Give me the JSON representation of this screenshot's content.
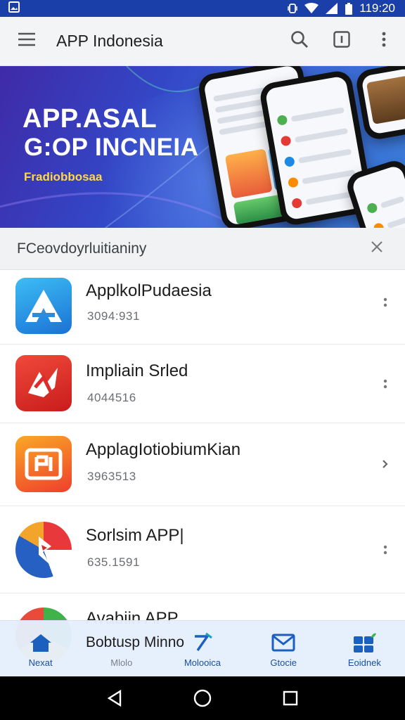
{
  "status_bar": {
    "time": "119:20",
    "icons": [
      "image-icon",
      "vibrate-icon",
      "wifi-icon",
      "signal-icon",
      "battery-icon"
    ]
  },
  "app_bar": {
    "title": "APP Indonesia",
    "icons": [
      "menu-icon",
      "search-icon",
      "info-icon",
      "more-vert-icon"
    ]
  },
  "banner": {
    "title_line1": "APP.ASAL",
    "title_line2": "G:OP INCNEIA",
    "subtitle": "Fradiobbosaa"
  },
  "section": {
    "title": "FCeovdoyrluitianiny",
    "close_icon": "close-icon"
  },
  "apps": [
    {
      "name": "ApplkolPudaesia",
      "count": "3094:931",
      "icon": "a-logo-icon",
      "colors": [
        "#2aa8ef",
        "#1b78d6"
      ]
    },
    {
      "name": "Impliain Srled",
      "count": "4044516",
      "icon": "splash-logo-icon",
      "colors": [
        "#ef3b2d",
        "#c41b1b"
      ]
    },
    {
      "name": "ApplagIotiobiumKian",
      "count": "3963513",
      "icon": "frame-logo-icon",
      "colors": [
        "#f7a227",
        "#ef4a2c"
      ]
    },
    {
      "name": "Sorlsim APP|",
      "count": "635.1591",
      "icon": "flag-logo-icon",
      "colors": [
        "#e8383b",
        "#2660c2"
      ]
    },
    {
      "name": "Avabiin APP",
      "count": "",
      "icon": "circle-logo-icon",
      "colors": [
        "#3fb24a",
        "#f2a322"
      ]
    }
  ],
  "bottom_nav": {
    "overlay_text": "Bobtusp Minno",
    "items": [
      {
        "label": "Nexat",
        "icon": "home-icon",
        "active": true
      },
      {
        "label": "Mlolo",
        "icon": "blank-icon",
        "active": false
      },
      {
        "label": "Molooica",
        "icon": "pen-icon",
        "active": true
      },
      {
        "label": "Gtocie",
        "icon": "mail-icon",
        "active": true
      },
      {
        "label": "Eoidnek",
        "icon": "apps-icon",
        "active": true
      }
    ]
  },
  "system_nav": [
    "back-icon",
    "home-circle-icon",
    "recents-icon"
  ]
}
